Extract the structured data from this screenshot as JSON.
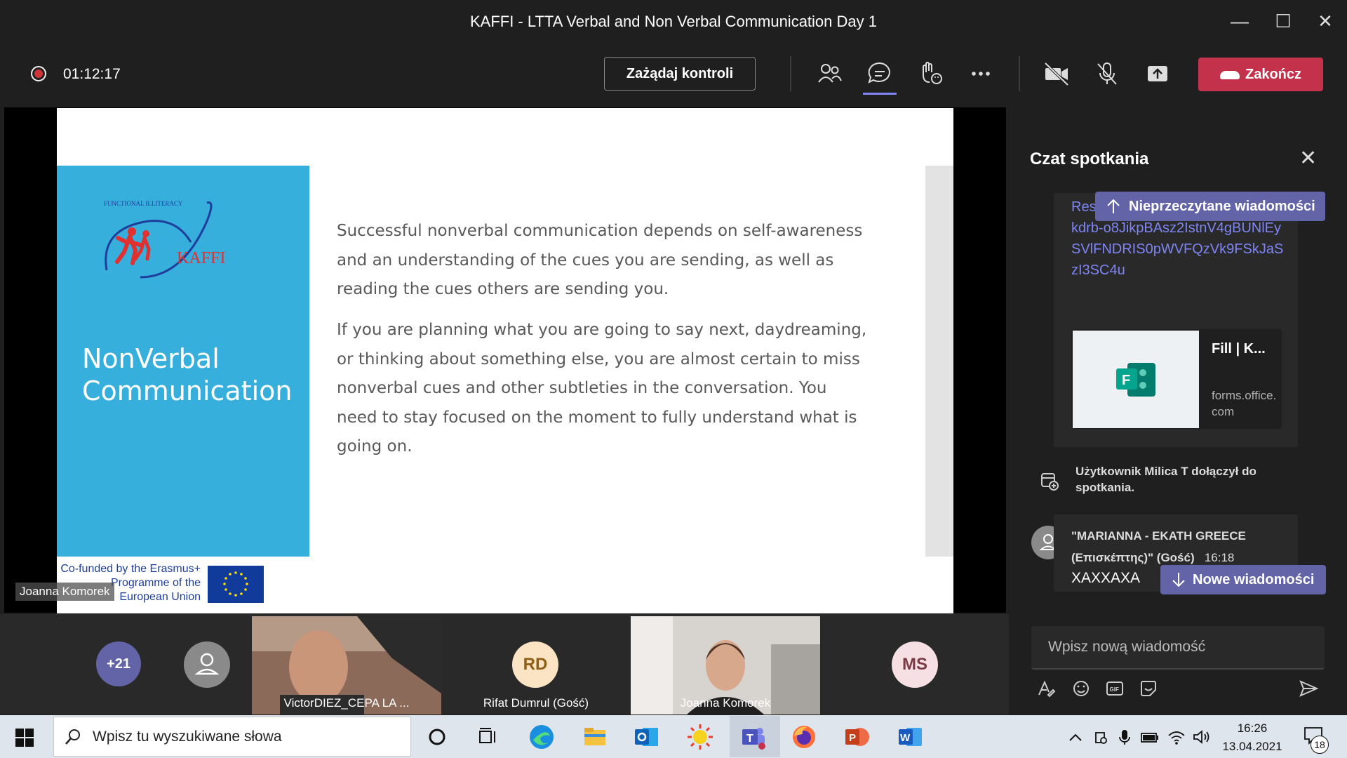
{
  "window": {
    "title": "KAFFI - LTTA Verbal and Non Verbal Communication Day 1",
    "controls": {
      "minimize": "—",
      "maximize": "☐",
      "close": "✕"
    }
  },
  "toolbar": {
    "timer": "01:12:17",
    "request_control_label": "Zażądaj kontroli",
    "end_label": "Zakończ",
    "icons": [
      "participants-icon",
      "chat-icon",
      "reactions-icon",
      "more-icon",
      "camera-off-icon",
      "mic-off-icon",
      "share-icon"
    ],
    "colors": {
      "end": "#c4314b",
      "active_underline": "#7f85f5"
    }
  },
  "slide": {
    "heading": "NonVerbal Communication",
    "paragraphs": [
      "Successful nonverbal communication depends on self-awareness and an understanding of the cues you are sending, as well as reading the cues others are sending you.",
      "If you are planning what you are going to say next, daydreaming, or thinking about something else, you are almost certain to miss nonverbal cues and other subtleties in the conversation. You need to stay focused on the moment to fully understand what is going on."
    ],
    "logo": {
      "small_text": "FUNCTIONAL ILLITERACY",
      "brand": "KAFFI"
    },
    "cofunded": "Co-funded by the Erasmus+ Programme of the European Union",
    "presenter": "Joanna Komorek",
    "colors": {
      "blue_panel": "#36afdd"
    }
  },
  "participants": {
    "overflow": "+21",
    "tiles": [
      {
        "name": "VictorDIEZ_CEPA LA ..."
      },
      {
        "initials": "RD",
        "name": "Rifat Dumrul (Gość)"
      },
      {
        "name": "Joanna Komorek"
      },
      {
        "initials": "MS"
      }
    ]
  },
  "chat": {
    "title": "Czat spotkania",
    "unread_label": "Nieprzeczytane wiadomości",
    "link_text": "Res  id=_FWNq7YRwU-AjXZdYMekdrb-o8JikpBAsz2IstnV4gBUNlEySVlFNDRIS0pWVFQzVk9FSkJaSzI3SC4u",
    "link_card": {
      "title": "Fill | K...",
      "domain": "forms.office.com"
    },
    "join_note": "Użytkownik Milica T dołączył do spotkania.",
    "message": {
      "author": "\"MARIANNA - EKATH GREECE (Επισκέπτης)\" (Gość)",
      "time": "16:18",
      "body": "XAXXAXA"
    },
    "new_label": "Nowe wiadomości",
    "input_placeholder": "Wpisz nową wiadomość"
  },
  "taskbar": {
    "search_placeholder": "Wpisz tu wyszukiwane słowa",
    "time": "16:26",
    "date": "13.04.2021",
    "notifications": "18"
  }
}
